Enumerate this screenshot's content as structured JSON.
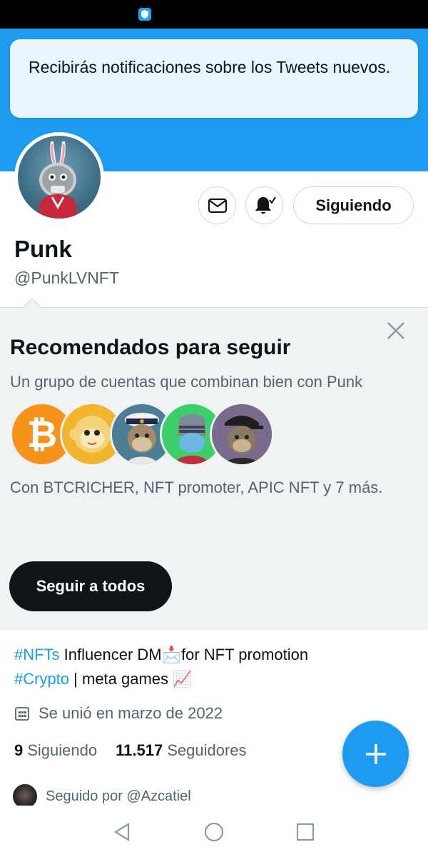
{
  "toast": {
    "message": "Recibirás notificaciones sobre los Tweets nuevos."
  },
  "profile": {
    "name": "Punk",
    "handle": "@PunkLVNFT",
    "following_button_label": "Siguiendo",
    "bio_tag1": "#NFTs",
    "bio_text1": " Influencer DM📩for NFT promotion",
    "bio_tag2": "#Crypto",
    "bio_text2": " | meta games 📈",
    "joined": "Se unió en marzo de 2022",
    "following_count": "9",
    "following_label": "Siguiendo",
    "followers_count": "11.517",
    "followers_label": "Seguidores",
    "followed_by": "Seguido por @Azcatiel"
  },
  "recommendations": {
    "title": "Recomendados para seguir",
    "subtitle": "Un grupo de cuentas que combinan bien con Punk",
    "with_text": "Con BTCRICHER, NFT promoter, APIC NFT y 7 más.",
    "follow_all_label": "Seguir a todos",
    "avatars": [
      "bitcoin-avatar",
      "monkey-avatar",
      "captain-ape-avatar",
      "knight-avatar",
      "cap-ape-avatar"
    ]
  },
  "colors": {
    "accent": "#1d9bf0",
    "banner": "#1d9bf0",
    "panel": "#eff3f4",
    "text": "#0f1419",
    "muted": "#536471"
  },
  "icons": {
    "message": "envelope-icon",
    "notifications": "bell-check-icon",
    "close": "close-icon",
    "calendar": "calendar-icon",
    "compose": "plus-icon"
  }
}
